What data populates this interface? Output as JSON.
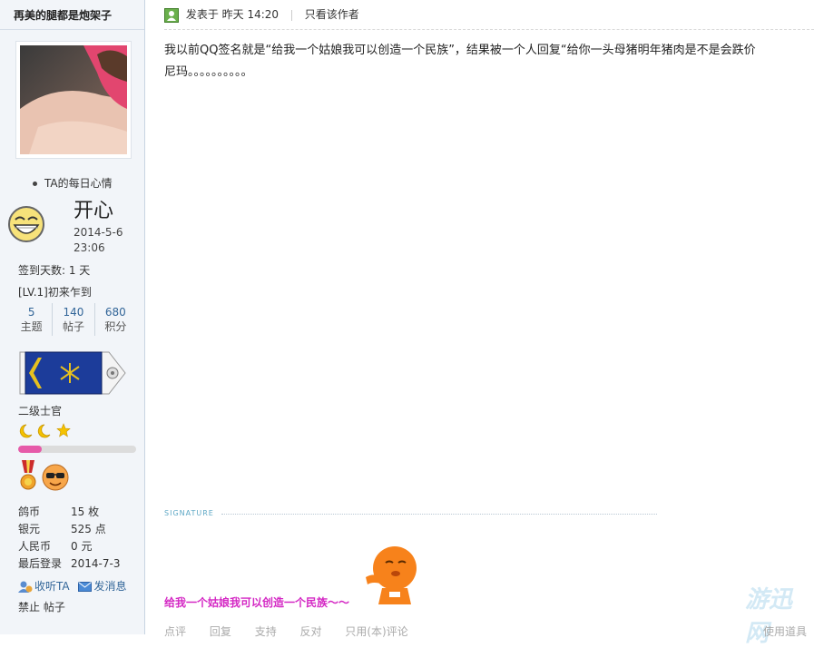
{
  "user": {
    "name": "再美的腿都是炮架子",
    "mood_heading": "TA的每日心情",
    "mood": "开心",
    "mood_date": "2014-5-6",
    "mood_time": "23:06",
    "signin_days": "签到天数: 1 天",
    "level": "[LV.1]初来乍到",
    "stats": [
      {
        "num": "5",
        "label": "主题"
      },
      {
        "num": "140",
        "label": "帖子"
      },
      {
        "num": "680",
        "label": "积分"
      }
    ],
    "rank_title": "二级士官",
    "progress_fraction": 0.2,
    "info": [
      {
        "key": "鸽币",
        "value": "15 枚"
      },
      {
        "key": "银元",
        "value": "525 点"
      },
      {
        "key": "人民币",
        "value": "0 元"
      },
      {
        "key": "最后登录",
        "value": "2014-7-3"
      }
    ],
    "follow_label": "收听TA",
    "message_label": "发消息",
    "ban_label": "禁止 帖子"
  },
  "post": {
    "posted_label": "发表于 昨天 14:20",
    "author_only": "只看该作者",
    "content_line1": "我以前QQ签名就是“给我一个姑娘我可以创造一个民族”，结果被一个人回复“给你一头母猪明年猪肉是不是会跌价",
    "content_line2": "尼玛。。。。。。。。。。",
    "signature_label": "SIGNATURE",
    "signature_text": "给我一个姑娘我可以创造一个民族～～",
    "watermark": "游迅网",
    "actions": [
      "点评",
      "回复",
      "支持",
      "反对",
      "只用(本)评论"
    ],
    "right_action": "使用道具"
  },
  "colors": {
    "link": "#336699",
    "signature": "#d428c4",
    "progress": "#e65aa9"
  }
}
